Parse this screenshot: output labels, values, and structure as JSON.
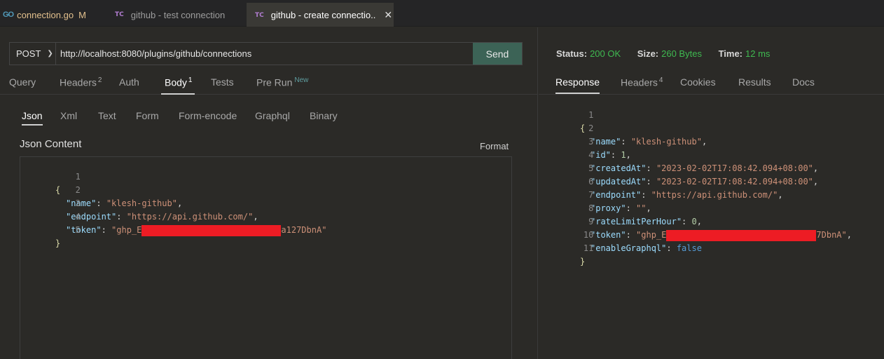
{
  "tabs": [
    {
      "icon": "go-file-icon",
      "label": "connection.go",
      "flag": "M"
    },
    {
      "icon": "tc-icon",
      "label": "github - test connection"
    },
    {
      "icon": "tc-icon",
      "label": "github - create connectio..",
      "close": "✕"
    }
  ],
  "request": {
    "method": "POST",
    "url": "http://localhost:8080/plugins/github/connections",
    "send_label": "Send",
    "tabs": [
      "Query",
      "Headers",
      "Auth",
      "Body",
      "Tests",
      "Pre Run"
    ],
    "headers_count": "2",
    "body_count": "1",
    "pre_run_badge": "New",
    "active_tab": "Body",
    "body_tabs": [
      "Json",
      "Xml",
      "Text",
      "Form",
      "Form-encode",
      "Graphql",
      "Binary"
    ],
    "active_body_tab": "Json",
    "json_content_label": "Json Content",
    "format_label": "Format",
    "body_lines": [
      "1",
      "2",
      "3",
      "4",
      "5"
    ],
    "body": {
      "name_key": "\"name\"",
      "name_val": "\"klesh-github\"",
      "endpoint_key": "\"endpoint\"",
      "endpoint_val": "\"https://api.github.com/\"",
      "token_key": "\"token\"",
      "token_prefix": "\"ghp_E",
      "token_suffix": "a127DbnA\""
    }
  },
  "response": {
    "status_label": "Status:",
    "status_value": "200 OK",
    "size_label": "Size:",
    "size_value": "260 Bytes",
    "time_label": "Time:",
    "time_value": "12 ms",
    "tabs": [
      "Response",
      "Headers",
      "Cookies",
      "Results",
      "Docs"
    ],
    "headers_count": "4",
    "active_tab": "Response",
    "body_lines": [
      "1",
      "2",
      "3",
      "4",
      "5",
      "6",
      "7",
      "8",
      "9",
      "10",
      "11"
    ],
    "body": {
      "name_key": "\"name\"",
      "name_val": "\"klesh-github\"",
      "id_key": "\"id\"",
      "id_val": "1",
      "created_key": "\"createdAt\"",
      "created_val": "\"2023-02-02T17:08:42.094+08:00\"",
      "updated_key": "\"updatedAt\"",
      "updated_val": "\"2023-02-02T17:08:42.094+08:00\"",
      "endpoint_key": "\"endpoint\"",
      "endpoint_val": "\"https://api.github.com/\"",
      "proxy_key": "\"proxy\"",
      "proxy_val": "\"\"",
      "rate_key": "\"rateLimitPerHour\"",
      "rate_val": "0",
      "token_key": "\"token\"",
      "token_prefix": "\"ghp_E",
      "token_suffix": "7DbnA\"",
      "graphql_key": "\"enableGraphql\"",
      "graphql_val": "false"
    }
  },
  "colors": {
    "background": "#2b2a27",
    "send_button": "#3c6356",
    "status_ok": "#3fb950",
    "redaction": "#ed1c24"
  }
}
